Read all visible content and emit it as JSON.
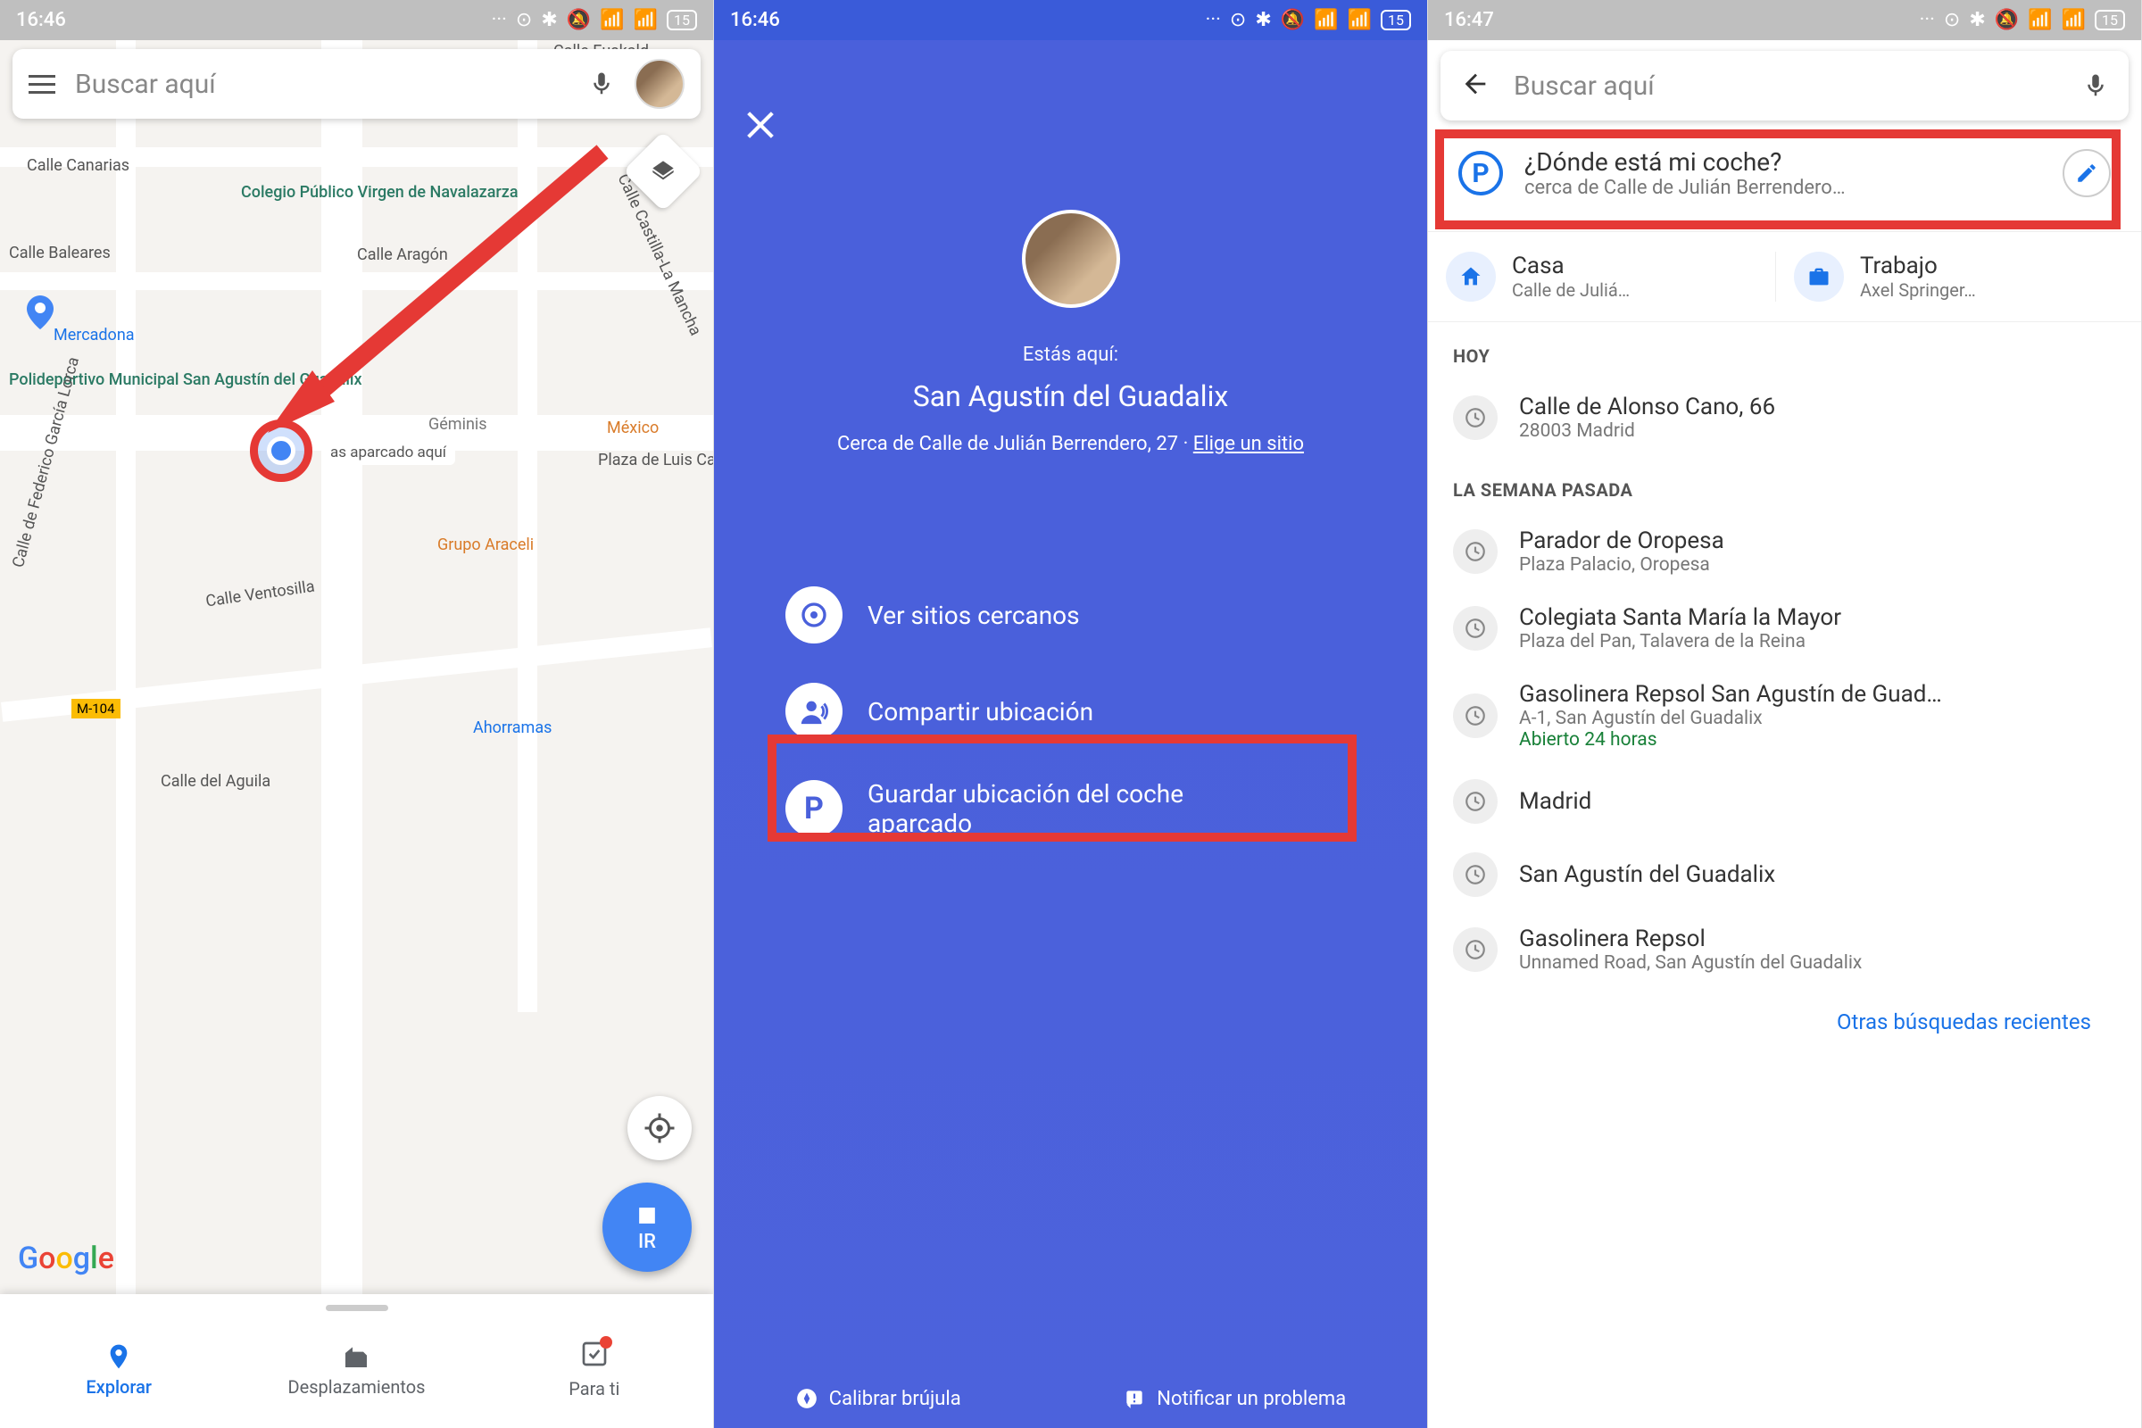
{
  "status": {
    "time1": "16:46",
    "time2": "16:46",
    "time3": "16:47",
    "battery": "15"
  },
  "s1": {
    "search_placeholder": "Buscar aquí",
    "go": "IR",
    "parked_hint": "as aparcado aquí",
    "nav": {
      "explore": "Explorar",
      "commute": "Desplazamientos",
      "foryou": "Para ti"
    },
    "map_labels": {
      "euskalduna": "Calle Euskald...",
      "canarias": "Calle Canarias",
      "baleares": "Calle Baleares",
      "colegio": "Colegio Público\nVirgen de Navalazarza",
      "aragon": "Calle Aragón",
      "castilla": "Calle Castilla-La Mancha",
      "mercadona": "Mercadona",
      "polideportivo": "Polideportivo Municipal\nSan Agustín del Guadalix",
      "geminis": "Géminis",
      "mexico": "México",
      "plaza": "Plaza de\nLuis Carre...",
      "araceli": "Grupo Araceli",
      "ventosilla": "Calle Ventosilla",
      "lorca": "Calle de Federico García Lorca",
      "m104": "M-104",
      "ahorramas": "Ahorramas",
      "aguila": "Calle del Aguila"
    }
  },
  "s2": {
    "here": "Estás aquí:",
    "location": "San Agustín del Guadalix",
    "near": "Cerca de Calle de Julián Berrendero, 27  ·  ",
    "choose": "Elige un sitio",
    "opt1": "Ver sitios cercanos",
    "opt2": "Compartir ubicación",
    "opt3": "Guardar ubicación del coche aparcado",
    "calibrate": "Calibrar brújula",
    "report": "Notificar un problema"
  },
  "s3": {
    "search_placeholder": "Buscar aquí",
    "parking": {
      "title": "¿Dónde está mi coche?",
      "sub": "cerca de Calle de Julián Berrendero…"
    },
    "home": {
      "label": "Casa",
      "sub": "Calle de Juliá…"
    },
    "work": {
      "label": "Trabajo",
      "sub": "Axel Springer…"
    },
    "today_hdr": "HOY",
    "today": [
      {
        "title": "Calle de Alonso Cano, 66",
        "sub": "28003 Madrid"
      }
    ],
    "lastweek_hdr": "LA SEMANA PASADA",
    "lastweek": [
      {
        "title": "Parador de Oropesa",
        "sub": "Plaza Palacio, Oropesa"
      },
      {
        "title": "Colegiata Santa María la Mayor",
        "sub": "Plaza del Pan, Talavera de la Reina"
      },
      {
        "title": "Gasolinera Repsol San Agustín de Guad…",
        "sub": "A-1, San Agustín del Guadalix",
        "open": "Abierto 24 horas"
      },
      {
        "title": "Madrid",
        "sub": ""
      },
      {
        "title": "San Agustín del Guadalix",
        "sub": ""
      },
      {
        "title": "Gasolinera Repsol",
        "sub": "Unnamed Road, San Agustín del Guadalix"
      }
    ],
    "more": "Otras búsquedas recientes"
  }
}
